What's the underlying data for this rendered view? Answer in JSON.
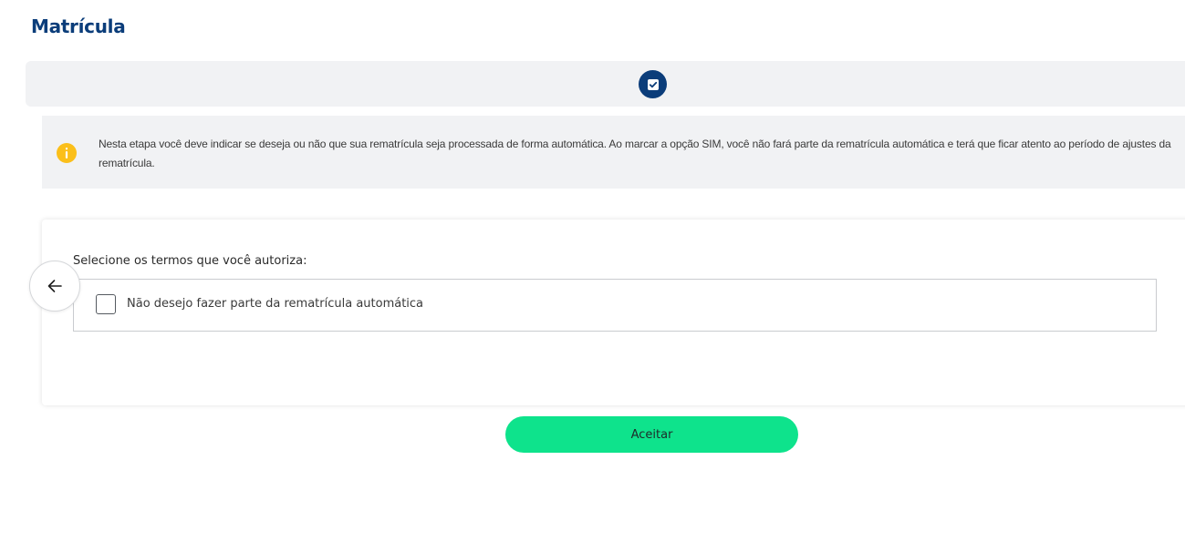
{
  "page": {
    "title": "Matrícula"
  },
  "stepper": {
    "current_step_icon": "checkbox-checked-icon",
    "accent": "#0b3d7a"
  },
  "info": {
    "icon": "info-icon",
    "icon_color": "#fbbf1a",
    "text": "Nesta etapa você deve indicar se deseja ou não que sua rematrícula seja processada de forma automática. Ao marcar a opção SIM, você não fará parte da rematrícula automática e terá que ficar atento ao período de ajustes da rematrícula."
  },
  "terms": {
    "heading": "Selecione os termos que você autoriza:",
    "options": [
      {
        "label": "Não desejo fazer parte da rematrícula automática",
        "checked": false
      }
    ]
  },
  "navigation": {
    "back_icon": "arrow-left-icon"
  },
  "actions": {
    "accept_label": "Aceitar",
    "accept_color": "#0ee38c"
  }
}
